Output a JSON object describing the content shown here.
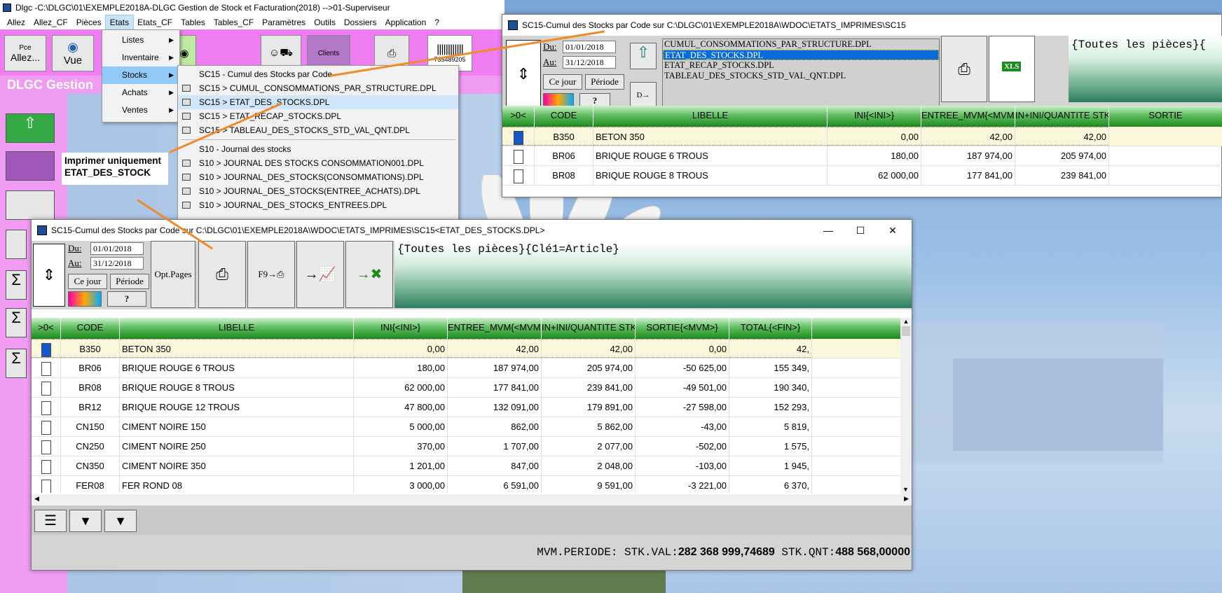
{
  "main_window": {
    "title": "Dlgc -C:\\DLGC\\01\\EXEMPLE2018A-DLGC Gestion de Stock et Facturation(2018) -->01-Superviseur",
    "menu": [
      "Allez",
      "Allez_CF",
      "Pièces",
      "Etats",
      "Etats_CF",
      "Tables",
      "Tables_CF",
      "Paramètres",
      "Outils",
      "Dossiers",
      "Application",
      "?"
    ],
    "toolbar": {
      "allez_top": "Pce",
      "allez_label": "Allez...",
      "vue_label": "Vue",
      "clients_label": "Clients",
      "barcode_text": "735489205"
    },
    "banner": "DLGC Gestion"
  },
  "etats_menu": {
    "items": [
      {
        "label": "Listes"
      },
      {
        "label": "Inventaire"
      },
      {
        "label": "Stocks"
      },
      {
        "label": "Achats"
      },
      {
        "label": "Ventes"
      }
    ]
  },
  "stocks_submenu": {
    "items": [
      "SC15 - Cumul des Stocks par Code",
      "SC15 > CUMUL_CONSOMMATIONS_PAR_STRUCTURE.DPL",
      "SC15 > ETAT_DES_STOCKS.DPL",
      "SC15 > ETAT_RECAP_STOCKS.DPL",
      "SC15 > TABLEAU_DES_STOCKS_STD_VAL_QNT.DPL",
      "S10 - Journal des stocks",
      "S10 > JOURNAL DES STOCKS CONSOMMATION001.DPL",
      "S10 > JOURNAL_DES_STOCKS(CONSOMMATIONS).DPL",
      "S10 > JOURNAL_DES_STOCKS(ENTREE_ACHATS).DPL",
      "S10 > JOURNAL_DES_STOCKS_ENTREES.DPL"
    ]
  },
  "callout": {
    "line1": "Imprimer uniquement",
    "line2": "ETAT_DES_STOCK"
  },
  "top_window": {
    "title": "SC15-Cumul des Stocks par Code sur C:\\DLGC\\01\\EXEMPLE2018A\\WDOC\\ETATS_IMPRIMES\\SC15",
    "du_label": "Du:",
    "au_label": "Au:",
    "du_value": "01/01/2018",
    "au_value": "31/12/2018",
    "ce_jour": "Ce jour",
    "periode": "Période",
    "help": "?",
    "dpl_label": "D→ DPL",
    "files": [
      "CUMUL_CONSOMMATIONS_PAR_STRUCTURE.DPL",
      "ETAT_DES_STOCKS.DPL",
      "ETAT_RECAP_STOCKS.DPL",
      "TABLEAU_DES_STOCKS_STD_VAL_QNT.DPL"
    ],
    "filter_text": "{Toutes les pièces}{",
    "xls_label": "XLS",
    "columns": [
      ">0<",
      "CODE",
      "LIBELLE",
      "INI{<INI>}",
      "ENTREE_MVM{<MVM>}",
      "IN+INI/QUANTITE STK/SF",
      "SORTIE"
    ],
    "rows": [
      {
        "code": "B350",
        "libelle": "BETON 350",
        "ini": "0,00",
        "entree": "42,00",
        "qte": "42,00"
      },
      {
        "code": "BR06",
        "libelle": "BRIQUE ROUGE 6 TROUS",
        "ini": "180,00",
        "entree": "187 974,00",
        "qte": "205 974,00"
      },
      {
        "code": "BR08",
        "libelle": "BRIQUE ROUGE 8 TROUS",
        "ini": "62 000,00",
        "entree": "177 841,00",
        "qte": "239 841,00"
      }
    ]
  },
  "front_window": {
    "title": "SC15-Cumul des Stocks par Code sur C:\\DLGC\\01\\EXEMPLE2018A\\WDOC\\ETATS_IMPRIMES\\SC15<ETAT_DES_STOCKS.DPL>",
    "du_label": "Du:",
    "au_label": "Au:",
    "du_value": "01/01/2018",
    "au_value": "31/12/2018",
    "ce_jour": "Ce jour",
    "periode": "Période",
    "help": "?",
    "opt_pages": "Opt.Pages",
    "f9_label": "F9",
    "filter_text": "{Toutes les pièces}{Clé1=Article}",
    "columns": [
      ">0<",
      "CODE",
      "LIBELLE",
      "INI{<INI>}",
      "ENTREE_MVM{<MVM>}",
      "IN+INI/QUANTITE STK/SF",
      "SORTIE{<MVM>}",
      "TOTAL{<FIN>}"
    ],
    "rows": [
      {
        "code": "B350",
        "libelle": "BETON 350",
        "ini": "0,00",
        "entree": "42,00",
        "qte": "42,00",
        "sortie": "0,00",
        "total": "42,"
      },
      {
        "code": "BR06",
        "libelle": "BRIQUE ROUGE 6 TROUS",
        "ini": "180,00",
        "entree": "187 974,00",
        "qte": "205 974,00",
        "sortie": "-50 625,00",
        "total": "155 349,"
      },
      {
        "code": "BR08",
        "libelle": "BRIQUE ROUGE 8 TROUS",
        "ini": "62 000,00",
        "entree": "177 841,00",
        "qte": "239 841,00",
        "sortie": "-49 501,00",
        "total": "190 340,"
      },
      {
        "code": "BR12",
        "libelle": "BRIQUE ROUGE 12 TROUS",
        "ini": "47 800,00",
        "entree": "132 091,00",
        "qte": "179 891,00",
        "sortie": "-27 598,00",
        "total": "152 293,"
      },
      {
        "code": "CN150",
        "libelle": "CIMENT NOIRE 150",
        "ini": "5 000,00",
        "entree": "862,00",
        "qte": "5 862,00",
        "sortie": "-43,00",
        "total": "5 819,"
      },
      {
        "code": "CN250",
        "libelle": "CIMENT NOIRE 250",
        "ini": "370,00",
        "entree": "1 707,00",
        "qte": "2 077,00",
        "sortie": "-502,00",
        "total": "1 575,"
      },
      {
        "code": "CN350",
        "libelle": "CIMENT NOIRE 350",
        "ini": "1 201,00",
        "entree": "847,00",
        "qte": "2 048,00",
        "sortie": "-103,00",
        "total": "1 945,"
      },
      {
        "code": "FER08",
        "libelle": "FER ROND 08",
        "ini": "3 000,00",
        "entree": "6 591,00",
        "qte": "9 591,00",
        "sortie": "-3 221,00",
        "total": "6 370,"
      }
    ],
    "footer": {
      "label": "MVM.PERIODE: STK.VAL:",
      "stk_val": "282 368 999,74689",
      "qnt_label": "STK.QNT:",
      "stk_qnt": "488 568,00000"
    }
  },
  "colors": {
    "accent_pink": "#f07ef3",
    "header_green": "#1d8a1d",
    "selection_blue": "#0a6ad8",
    "callout_line": "#f08a2a"
  }
}
